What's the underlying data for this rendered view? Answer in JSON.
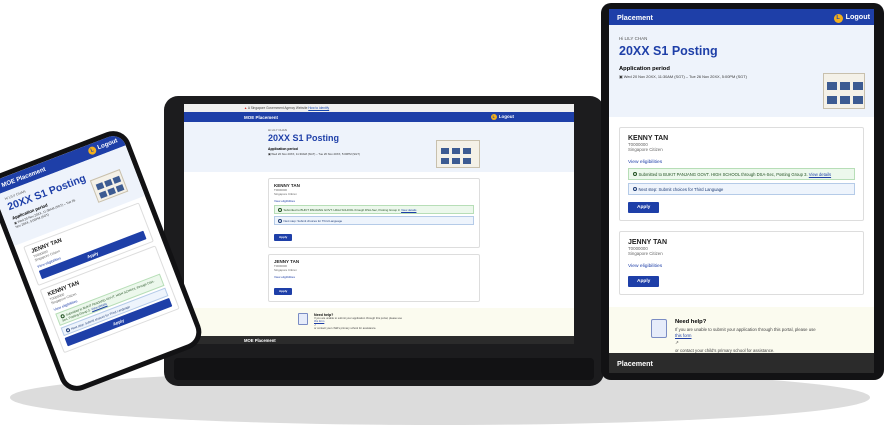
{
  "app": {
    "brand": "MOE Placement",
    "brand_short": "Placement",
    "logout_label": "Logout",
    "avatar_initial": "L",
    "gov_banner_text": "A Singapore Government Agency Website",
    "gov_banner_link": "How to identify"
  },
  "page": {
    "greeting": "Hi LILY CHAN",
    "title": "20XX S1 Posting",
    "application_period_label": "Application period",
    "application_period": "Wed 20 Nov 20XX, 11:30AM (SGT) – Tue 26 Nov 20XX, 5:00PM (SGT)"
  },
  "children": [
    {
      "name": "KENNY TAN",
      "id": "T0000000",
      "status": "Singapore Citizen",
      "eligibility_link": "View eligibilities",
      "submission_text": "Submitted to BUKIT PANJANG GOVT. HIGH SCHOOL through DSA-Sec, Posting Group 3.",
      "submission_link": "View details",
      "next_step": "Next step: Submit choices for Third Language",
      "apply_label": "Apply"
    },
    {
      "name": "JENNY TAN",
      "id": "T0000000",
      "status": "Singapore Citizen",
      "eligibility_link": "View eligibilities",
      "apply_label": "Apply"
    }
  ],
  "help": {
    "title": "Need help?",
    "text_before": "If you are unable to submit your application through this portal, please use",
    "link": "this form",
    "text_after": "or contact your child's primary school for assistance."
  },
  "footer": {
    "brand": "MOE Placement",
    "brand_short": "Placement"
  },
  "colors": {
    "primary": "#1e3fa8",
    "avatar": "#f2b01e",
    "footer": "#2b2b2b",
    "hero_bg": "#eef3fb",
    "success_bg": "#ecf8ec",
    "info_bg": "#eef4fc"
  }
}
